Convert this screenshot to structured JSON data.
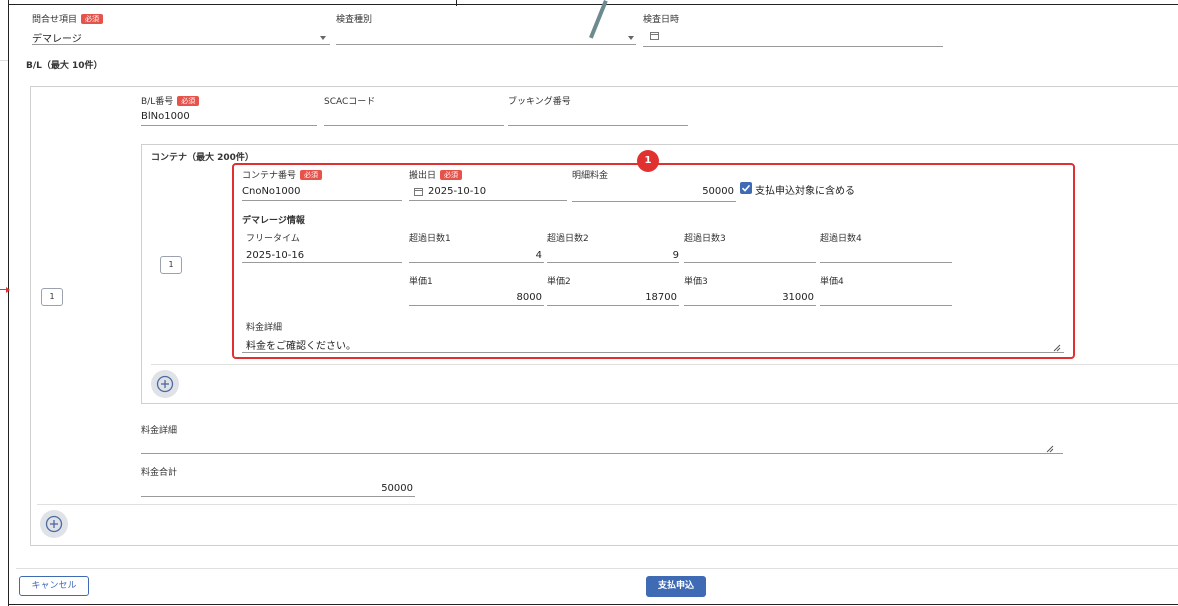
{
  "header": {
    "inquiry_label": "問合せ項目",
    "required": "必須",
    "inquiry_value": "デマレージ",
    "inspection_type_label": "検査種別",
    "inspection_type_value": "",
    "inspection_date_label": "検査日時",
    "inspection_date_value": ""
  },
  "bl_section": {
    "title": "B/L（最大 10件）",
    "index": "1",
    "bl_number_label": "B/L番号",
    "bl_number_value": "BlNo1000",
    "scac_label": "SCACコード",
    "scac_value": "",
    "booking_label": "ブッキング番号",
    "booking_value": "",
    "fee_detail_label": "料金詳細",
    "fee_detail_value": "",
    "fee_total_label": "料金合計",
    "fee_total_value": "50000"
  },
  "container_section": {
    "title": "コンテナ（最大 200件）",
    "index": "1",
    "container_no_label": "コンテナ番号",
    "container_no_value": "CnoNo1000",
    "carry_out_label": "搬出日",
    "carry_out_value": "2025-10-10",
    "detail_fee_label": "明細料金",
    "detail_fee_value": "50000",
    "checkbox_label": "支払申込対象に含める",
    "checkbox_checked": true,
    "demurrage_title": "デマレージ情報",
    "free_time_label": "フリータイム",
    "free_time_value": "2025-10-16",
    "overdays": [
      {
        "label": "超過日数1",
        "value": "4"
      },
      {
        "label": "超過日数2",
        "value": "9"
      },
      {
        "label": "超過日数3",
        "value": ""
      },
      {
        "label": "超過日数4",
        "value": ""
      }
    ],
    "unit_prices": [
      {
        "label": "単価1",
        "value": "8000"
      },
      {
        "label": "単価2",
        "value": "18700"
      },
      {
        "label": "単価3",
        "value": "31000"
      },
      {
        "label": "単価4",
        "value": ""
      }
    ],
    "fee_detail_label": "料金詳細",
    "fee_detail_value": "料金をご確認ください。"
  },
  "annotation": {
    "badge": "1",
    "highlight_color": "#e03030"
  },
  "footer": {
    "cancel": "キャンセル",
    "submit": "支払申込"
  },
  "colors": {
    "submit_bg": "#3f6bb5",
    "required_bg": "#e5534b",
    "checkbox": "#3f6bb5"
  }
}
